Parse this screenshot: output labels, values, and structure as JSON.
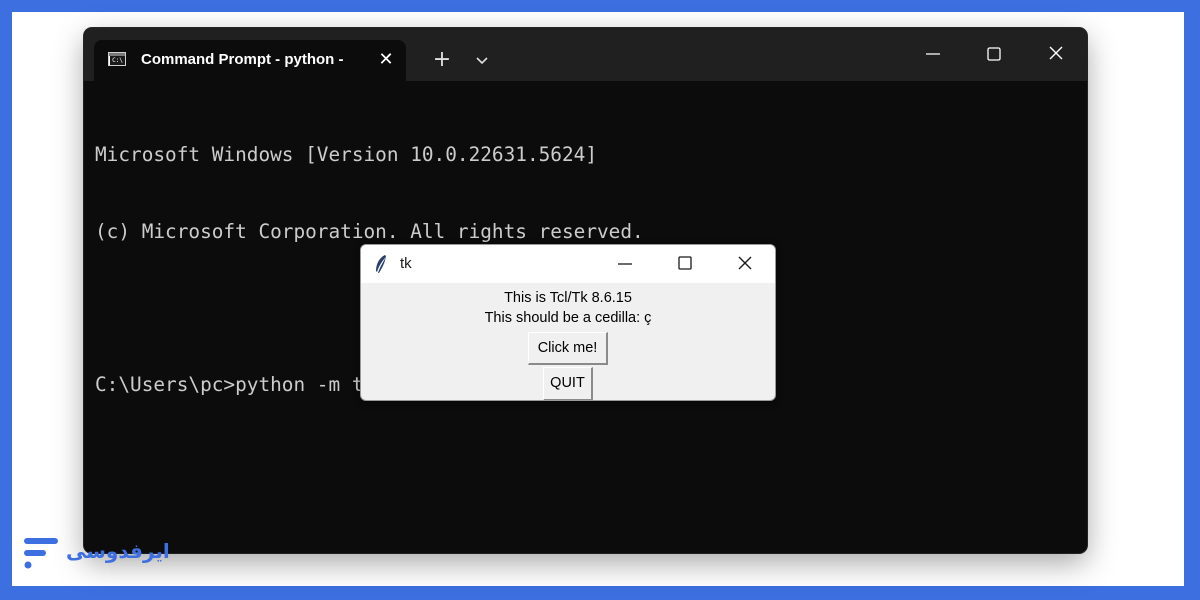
{
  "terminal": {
    "tab_title": "Command Prompt - python  -",
    "tab_icon_glyph": "C:\\",
    "lines": [
      "Microsoft Windows [Version 10.0.22631.5624]",
      "(c) Microsoft Corporation. All rights reserved.",
      "",
      "C:\\Users\\pc>python -m tkinter"
    ]
  },
  "tk_window": {
    "title": "tk",
    "label1": "This is Tcl/Tk 8.6.15",
    "label2": "This should be a cedilla: ç",
    "click_button": "Click me!",
    "quit_button": "QUIT"
  },
  "watermark": {
    "text": "ایرفدوسی"
  },
  "colors": {
    "border_accent": "#3d6fe0",
    "terminal_bg": "#0c0c0c",
    "titlebar_bg": "#202020",
    "tk_bg": "#f0f0f0"
  }
}
